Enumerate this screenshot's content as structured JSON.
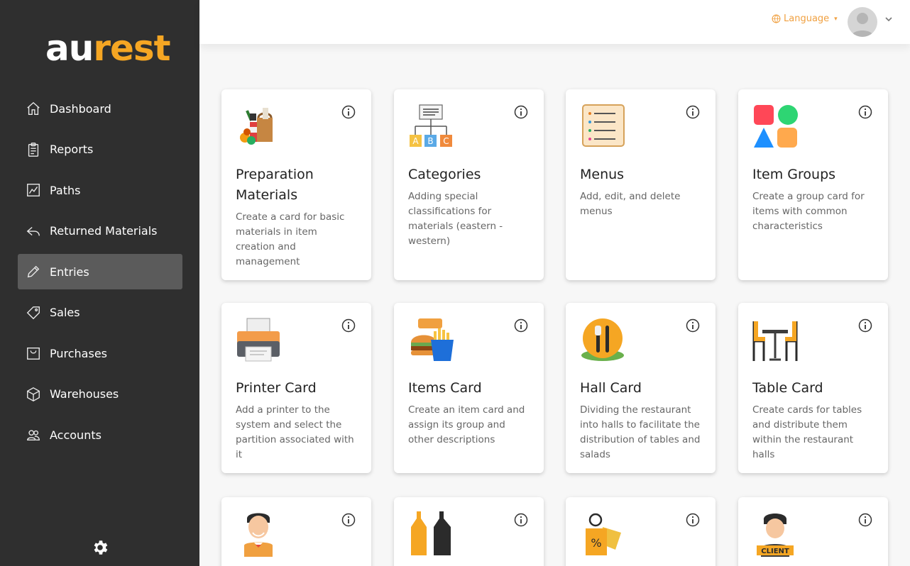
{
  "brand": {
    "part1": "au",
    "part2": "rest"
  },
  "sidebar": {
    "items": [
      {
        "label": "Dashboard",
        "icon": "home-icon",
        "active": false
      },
      {
        "label": "Reports",
        "icon": "clipboard-icon",
        "active": false
      },
      {
        "label": "Paths",
        "icon": "chart-icon",
        "active": false
      },
      {
        "label": "Returned Materials",
        "icon": "reply-icon",
        "active": false
      },
      {
        "label": "Entries",
        "icon": "pencil-icon",
        "active": true
      },
      {
        "label": "Sales",
        "icon": "tag-icon",
        "active": false
      },
      {
        "label": "Purchases",
        "icon": "bag-icon",
        "active": false
      },
      {
        "label": "Warehouses",
        "icon": "box-icon",
        "active": false
      },
      {
        "label": "Accounts",
        "icon": "users-icon",
        "active": false
      }
    ]
  },
  "header": {
    "language_label": "Language"
  },
  "cards": [
    {
      "title": "Preparation Materials",
      "desc": "Create a card for basic materials in item creation and management",
      "icon": "groceries-icon"
    },
    {
      "title": "Categories",
      "desc": "Adding special classifications for materials (eastern - western)",
      "icon": "abc-hierarchy-icon"
    },
    {
      "title": "Menus",
      "desc": "Add, edit, and delete menus",
      "icon": "menu-list-icon"
    },
    {
      "title": "Item Groups",
      "desc": "Create a group card for items with common characteristics",
      "icon": "shapes-icon"
    },
    {
      "title": "Printer Card",
      "desc": "Add a printer to the system and select the partition associated with it",
      "icon": "printer-icon"
    },
    {
      "title": "Items Card",
      "desc": "Create an item card and assign its group and other descriptions",
      "icon": "fast-food-icon"
    },
    {
      "title": "Hall Card",
      "desc": "Dividing the restaurant into halls to facilitate the distribution of tables and salads",
      "icon": "hall-icon"
    },
    {
      "title": "Table Card",
      "desc": "Create cards for tables and distribute them within the restaurant halls",
      "icon": "table-chairs-icon"
    },
    {
      "title": "",
      "desc": "",
      "icon": "waiter-icon"
    },
    {
      "title": "",
      "desc": "",
      "icon": "sauce-bottles-icon"
    },
    {
      "title": "",
      "desc": "",
      "icon": "discount-tag-icon"
    },
    {
      "title": "",
      "desc": "",
      "icon": "client-icon"
    }
  ],
  "colors": {
    "sidebar": "#2f2f2f",
    "active": "#5b5b5b",
    "accent": "#f5a623"
  }
}
